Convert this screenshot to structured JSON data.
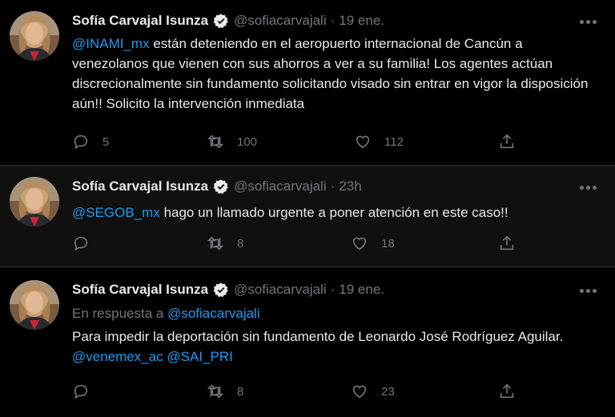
{
  "tweets": [
    {
      "name": "Sofía Carvajal Isunza",
      "handle": "@sofiacarvajali",
      "dot": "·",
      "time": "19 ene.",
      "text_mention": "@INAMI_mx",
      "text": " están deteniendo en el aeropuerto internacional de Cancún a venezolanos que vienen con sus ahorros a ver a su familia! Los agentes actúan discrecionalmente sin fundamento solicitando visado sin entrar en vigor la disposición aún!! Solicito la intervención inmediata",
      "replies": "5",
      "retweets": "100",
      "likes": "112"
    },
    {
      "name": "Sofía Carvajal Isunza",
      "handle": "@sofiacarvajali",
      "dot": "·",
      "time": "23h",
      "text_mention": "@SEGOB_mx",
      "text": " hago un llamado urgente a poner atención en este caso!!",
      "replies": "",
      "retweets": "8",
      "likes": "18"
    },
    {
      "name": "Sofía Carvajal Isunza",
      "handle": "@sofiacarvajali",
      "dot": "·",
      "time": "19 ene.",
      "reply_prefix": "En respuesta a ",
      "reply_handle": "@sofiacarvajali",
      "text": "Para impedir la deportación sin fundamento de Leonardo José Rodríguez Aguilar. ",
      "mention_a": "@venemex_ac",
      "mention_b": "@SAI_PRI",
      "replies": "",
      "retweets": "8",
      "likes": "23"
    }
  ],
  "icons": [
    "verified-badge-icon",
    "more-icon",
    "reply-icon",
    "retweet-icon",
    "like-icon",
    "share-icon"
  ],
  "colors": {
    "background": "#000000",
    "highlight_bg": "#101010",
    "link": "#1d9bf0",
    "muted": "#71767b",
    "text": "#e7e9ea"
  }
}
